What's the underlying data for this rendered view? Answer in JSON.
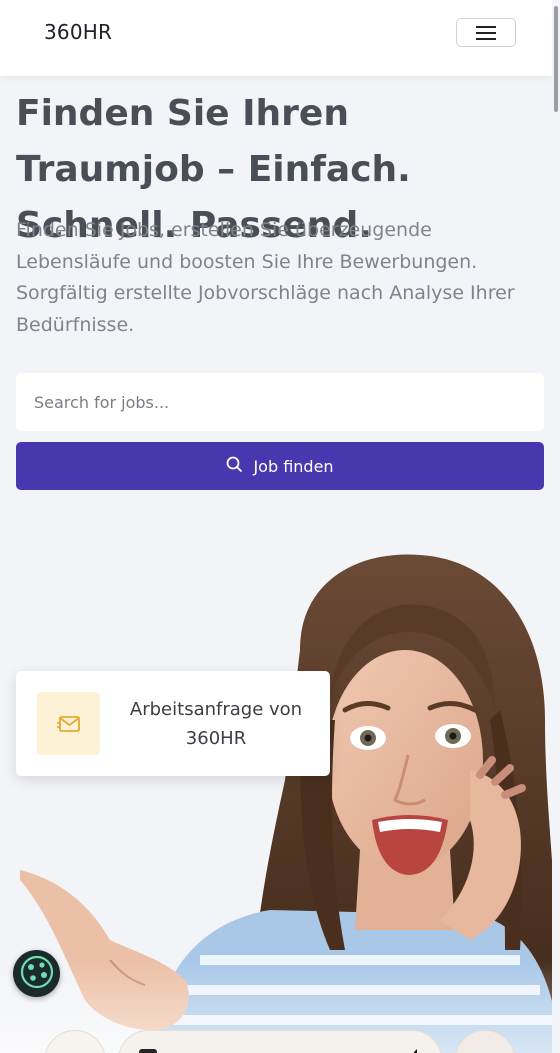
{
  "header": {
    "brand": "360HR",
    "menu_icon": "hamburger-icon"
  },
  "hero": {
    "title": "Finden Sie Ihren Traumjob – Einfach. Schnell. Passend.",
    "subtitle": "Finden Sie Jobs, erstellen Sie überzeugende Lebensläufe und boosten Sie Ihre Bewerbungen. Sorgfältig erstellte Jobvorschläge nach Analyse Ihrer Bedürfnisse."
  },
  "search": {
    "placeholder": "Search for jobs...",
    "button_label": "Job finden",
    "button_icon": "search-icon"
  },
  "notification": {
    "icon": "envelope-icon",
    "text": "Arbeitsanfrage von 360HR"
  },
  "cookie": {
    "icon": "cookie-icon"
  },
  "colors": {
    "accent": "#4838b0",
    "background": "#f3f4f7",
    "notif_icon_bg": "#fdf1d6",
    "notif_icon": "#e8b53a"
  }
}
